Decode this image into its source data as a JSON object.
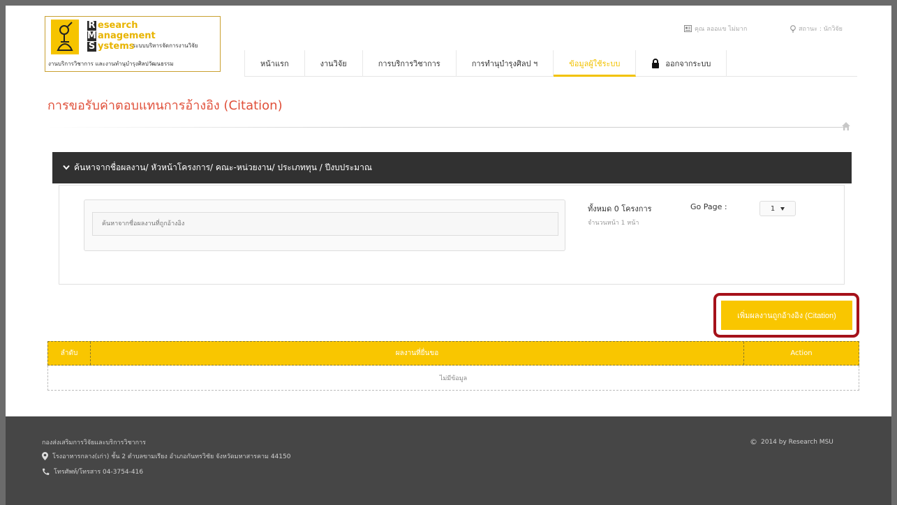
{
  "logo": {
    "line1": "esearch",
    "line2": "anagement",
    "line3": "ystems",
    "cap1": "R",
    "cap2": "M",
    "cap3": "S",
    "subtitle": "ระบบบริหารจัดการงานวิจัย",
    "bottom": "งานบริการวิชาการ และงานทำนุบำรุงศิลปวัฒนธรรม"
  },
  "topbar": {
    "user": "คุณ ลออแข ไม่มาก",
    "status": "สถานะ : นักวิจัย"
  },
  "nav": {
    "items": [
      {
        "label": "หน้าแรก"
      },
      {
        "label": "งานวิจัย"
      },
      {
        "label": "การบริการวิชาการ"
      },
      {
        "label": "การทำนุบำรุงศิลป ฯ"
      },
      {
        "label": "ข้อมูลผู้ใช้ระบบ"
      }
    ],
    "logout": "ออกจากระบบ"
  },
  "page": {
    "title": "การขอรับค่าตอบแทนการอ้างอิง (Citation)"
  },
  "search": {
    "header": "ค้นหาจากชื่อผลงาน/ หัวหน้าโครงการ/ คณะ-หน่วยงาน/ ประเภททุน / ปีงบประมาณ",
    "placeholder": "ค้นหาจากชื่อผลงานที่ถูกอ้างอิง",
    "total": "ทั้งหมด 0 โครงการ",
    "pages": "จำนวนหน้า 1 หน้า",
    "go_page_label": "Go Page :",
    "page_value": "1"
  },
  "add_button": "เพิ่มผลงานถูกอ้างอิง (Citation)",
  "table": {
    "headers": [
      "ลำดับ",
      "ผลงานที่ยื่นขอ",
      "Action"
    ],
    "empty": "ไม่มีข้อมูล"
  },
  "footer": {
    "org": "กองส่งเสริมการวิจัยและบริการวิชาการ",
    "address": "โรงอาหารกลาง(เก่า) ชั้น 2 ตำบลขามเรียง อำเภอกันทรวิชัย จังหวัดมหาสารคาม 44150",
    "phone": "โทรศัพท์/โทรสาร 04-3754-416",
    "copyright": "2014 by Research MSU"
  },
  "colors": {
    "accent": "#f9c600",
    "title": "#e0503a",
    "highlight_outline": "#a5111a",
    "footer_bg": "#464646",
    "search_bar_bg": "#313131"
  }
}
